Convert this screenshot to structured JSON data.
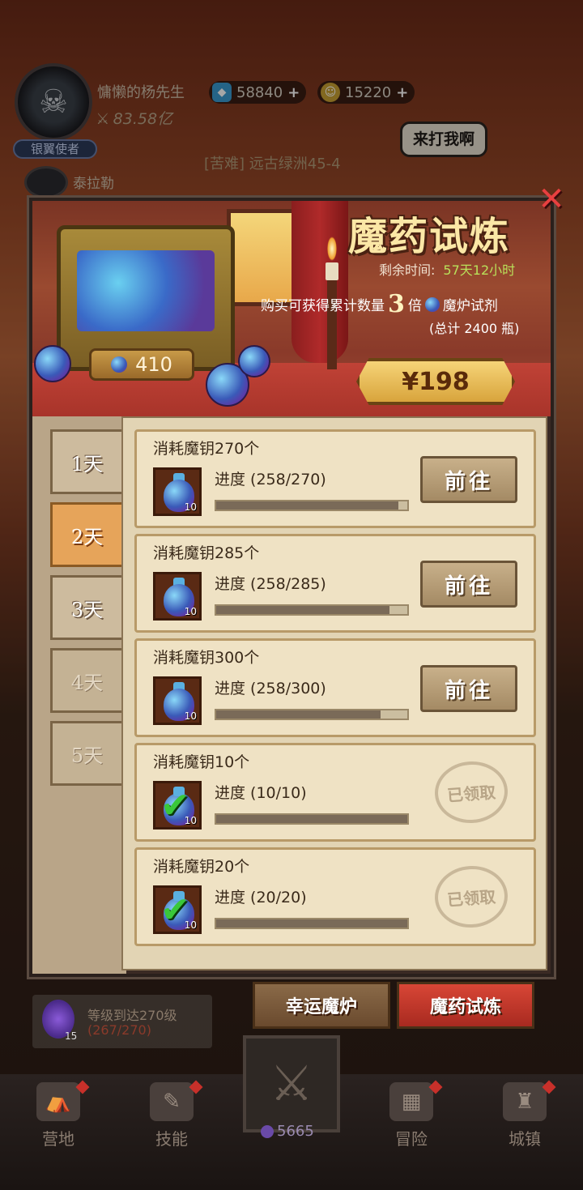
{
  "hud": {
    "player_name": "慵懒的杨先生",
    "power": "83.58亿",
    "title_badge": "银翼使者",
    "gems": "58840",
    "coins": "15220",
    "speech": "来打我啊",
    "stage": "[苦难] 远古绿洲45-4",
    "ally_name": "泰拉勒"
  },
  "event": {
    "title": "魔药试炼",
    "timer_label": "剩余时间:",
    "timer_value": "57天12小时",
    "buy_prefix": "购买可获得累计数量",
    "multiplier": "3",
    "multiplier_suffix": "倍",
    "reagent_name": "魔炉试剂",
    "total": "(总计 2400 瓶)",
    "chest_count": "410",
    "price": "¥198",
    "close_icon": "close-icon"
  },
  "days": [
    {
      "label": "1天",
      "state": "normal"
    },
    {
      "label": "2天",
      "state": "active"
    },
    {
      "label": "3天",
      "state": "normal"
    },
    {
      "label": "4天",
      "state": "locked"
    },
    {
      "label": "5天",
      "state": "locked"
    }
  ],
  "tasks": [
    {
      "name": "消耗魔钥270个",
      "progress": "进度 (258/270)",
      "ratio": 0.955,
      "qty": "10",
      "action": "前往",
      "claimed": false
    },
    {
      "name": "消耗魔钥285个",
      "progress": "进度 (258/285)",
      "ratio": 0.905,
      "qty": "10",
      "action": "前往",
      "claimed": false
    },
    {
      "name": "消耗魔钥300个",
      "progress": "进度 (258/300)",
      "ratio": 0.86,
      "qty": "10",
      "action": "前往",
      "claimed": false
    },
    {
      "name": "消耗魔钥10个",
      "progress": "进度 (10/10)",
      "ratio": 1.0,
      "qty": "10",
      "action": "已领取",
      "claimed": true
    },
    {
      "name": "消耗魔钥20个",
      "progress": "进度 (20/20)",
      "ratio": 1.0,
      "qty": "10",
      "action": "已领取",
      "claimed": true
    }
  ],
  "bottom_tabs": {
    "lucky": "幸运魔炉",
    "trial": "魔药试炼"
  },
  "quest": {
    "level": "15",
    "text": "等级到达270级",
    "progress": "(267/270)"
  },
  "nav": [
    {
      "label": "营地",
      "icon": "tent-icon"
    },
    {
      "label": "技能",
      "icon": "scroll-icon"
    },
    {
      "label": "冒险",
      "icon": "map-icon"
    },
    {
      "label": "城镇",
      "icon": "castle-icon"
    }
  ],
  "center": {
    "count": "5665"
  }
}
